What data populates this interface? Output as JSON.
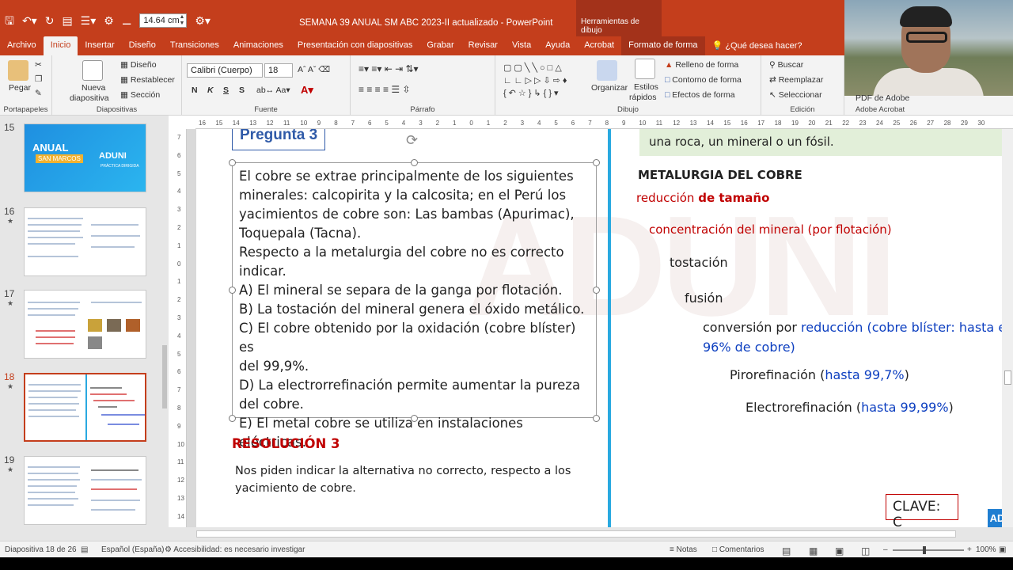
{
  "window": {
    "title": "SEMANA 39 ANUAL SM ABC 2023-II actualizado  -  PowerPoint",
    "context_tools": "Herramientas de dibujo",
    "shape_width": "14.64 cm"
  },
  "tabs": [
    "Archivo",
    "Inicio",
    "Insertar",
    "Diseño",
    "Transiciones",
    "Animaciones",
    "Presentación con diapositivas",
    "Grabar",
    "Revisar",
    "Vista",
    "Ayuda",
    "Acrobat",
    "Formato de forma"
  ],
  "tell_me": "¿Qué desea hacer?",
  "ribbon": {
    "portapapeles": {
      "label": "Portapapeles",
      "paste": "Pegar"
    },
    "diapositivas": {
      "label": "Diapositivas",
      "new_slide": "Nueva",
      "new_slide2": "diapositiva",
      "layout": "Diseño",
      "reset": "Restablecer",
      "section": "Sección"
    },
    "fuente": {
      "label": "Fuente",
      "font": "Calibri (Cuerpo)",
      "size": "18",
      "bold": "N",
      "italic": "K",
      "underline": "S",
      "strike": "S"
    },
    "parrafo": {
      "label": "Párrafo"
    },
    "dibujo": {
      "label": "Dibujo",
      "arrange": "Organizar",
      "styles": "Estilos",
      "styles2": "rápidos",
      "fill": "Relleno de forma",
      "outline": "Contorno de forma",
      "effects": "Efectos de forma"
    },
    "edicion": {
      "label": "Edición",
      "find": "Buscar",
      "replace": "Reemplazar",
      "select": "Seleccionar"
    },
    "adobe": {
      "label": "Adobe Acrobat",
      "pdf": "PDF de Adobe"
    }
  },
  "thumbnails": [
    {
      "num": "15",
      "star": false,
      "title": "ANUAL",
      "subtitle": "SAN MARCOS",
      "brand": "ADUNI",
      "note": "PRÁCTICA DIRIGIDA"
    },
    {
      "num": "16",
      "star": true
    },
    {
      "num": "17",
      "star": true
    },
    {
      "num": "18",
      "star": true,
      "selected": true
    },
    {
      "num": "19",
      "star": true
    }
  ],
  "ruler_h": [
    "16",
    "15",
    "14",
    "13",
    "12",
    "11",
    "10",
    "9",
    "8",
    "7",
    "6",
    "5",
    "4",
    "3",
    "2",
    "1",
    "0",
    "1",
    "2",
    "3",
    "4",
    "5",
    "6",
    "7",
    "8",
    "9",
    "10",
    "11",
    "12",
    "13",
    "14",
    "15",
    "16",
    "17",
    "18",
    "19",
    "20",
    "21",
    "22",
    "23",
    "24",
    "25",
    "26",
    "27",
    "28",
    "29",
    "30"
  ],
  "ruler_v": [
    "7",
    "6",
    "5",
    "4",
    "3",
    "2",
    "1",
    "0",
    "1",
    "2",
    "3",
    "4",
    "5",
    "6",
    "7",
    "8",
    "9",
    "10",
    "11",
    "12",
    "13",
    "14"
  ],
  "slide": {
    "question_title": "Pregunta 3",
    "question_lines": [
      "El cobre se extrae principalmente de los siguientes",
      "minerales: calcopirita y la calcosita; en el Perú los",
      "yacimientos de cobre son: Las bambas (Apurimac),",
      "Toquepala (Tacna).",
      "Respecto a la metalurgia del cobre no es correcto",
      "indicar.",
      "A) El mineral se separa de la ganga por flotación.",
      "B) La tostación del mineral genera el óxido metálico.",
      "C) El cobre obtenido por la oxidación (cobre blíster) es",
      "del 99,9%.",
      "D) La electrorrefinación permite aumentar la pureza",
      "del cobre.",
      "E) El metal cobre se utiliza en instalaciones eléctricas."
    ],
    "resolution_title": "RESOLUCIÓN 3",
    "resolution_text": "Nos piden indicar la alternativa no correcto, respecto a los yacimiento de cobre.",
    "green_box_text": "una roca, un mineral o un fósil.",
    "metallurgy_title": "METALURGIA DEL COBRE",
    "step1_a": "reducción ",
    "step1_b": "de tamaño",
    "step2": "concentración del mineral (por flotación)",
    "step3": "tostación",
    "step4": "fusión",
    "step5_a": "conversión por ",
    "step5_b": "reducción (cobre blíster: hasta el",
    "step5_c": "96% de cobre)",
    "step6_a": "Pirorefinación (",
    "step6_b": "hasta 99,7%",
    "step6_c": ")",
    "step7_a": "Electrorefinación (",
    "step7_b": "hasta 99,99%",
    "step7_c": ")",
    "answer": "CLAVE: C",
    "corner_logo": "AD"
  },
  "status": {
    "slide_info": "Diapositiva 18 de 26",
    "language": "Español (España)",
    "accessibility": "Accesibilidad: es necesario investigar",
    "notes": "Notas",
    "comments": "Comentarios",
    "zoom": "100%"
  },
  "colors": {
    "accent": "#c43e1c",
    "title_blue": "#2f5aa8",
    "red": "#c00000",
    "blue": "#0d3fc0",
    "divider": "#29a9e0"
  }
}
